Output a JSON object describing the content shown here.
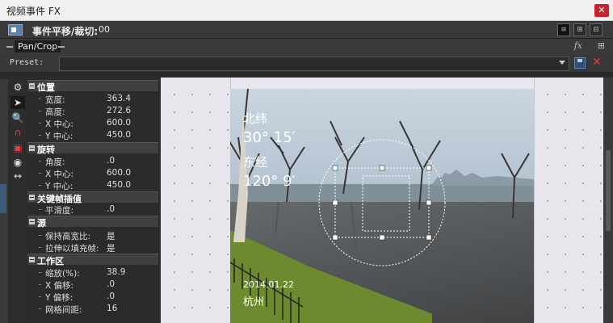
{
  "window": {
    "title": "视频事件 FX",
    "close_glyph": "✕"
  },
  "header": {
    "event_label": "事件平移/裁切:",
    "event_value": "00"
  },
  "tab": {
    "label": "Pan/Crop"
  },
  "preset": {
    "label": "Preset:",
    "value": ""
  },
  "sections": {
    "position": {
      "name": "位置",
      "width_k": "宽度:",
      "width_v": "363.4",
      "height_k": "高度:",
      "height_v": "272.6",
      "xc_k": "X 中心:",
      "xc_v": "600.0",
      "yc_k": "Y 中心:",
      "yc_v": "450.0"
    },
    "rotation": {
      "name": "旋转",
      "angle_k": "角度:",
      "angle_v": ".0",
      "xc_k": "X 中心:",
      "xc_v": "600.0",
      "yc_k": "Y 中心:",
      "yc_v": "450.0"
    },
    "keyframe": {
      "name": "关键帧插值",
      "smooth_k": "平滑度:",
      "smooth_v": ".0"
    },
    "source": {
      "name": "源",
      "keep_k": "保持高宽比:",
      "keep_v": "是",
      "stretch_k": "拉伸以填充帧:",
      "stretch_v": "是"
    },
    "workspace": {
      "name": "工作区",
      "zoom_k": "缩放(%):",
      "zoom_v": "38.9",
      "xo_k": "X 偏移:",
      "xo_v": ".0",
      "yo_k": "Y 偏移:",
      "yo_v": ".0",
      "grid_k": "网格间距:",
      "grid_v": "16"
    }
  },
  "photo_text": {
    "lat_label": "北纬",
    "lat_value": "30° 15′",
    "lon_label": "东经",
    "lon_value": "120° 9′",
    "date": "2014.01.22",
    "place": "杭州"
  }
}
